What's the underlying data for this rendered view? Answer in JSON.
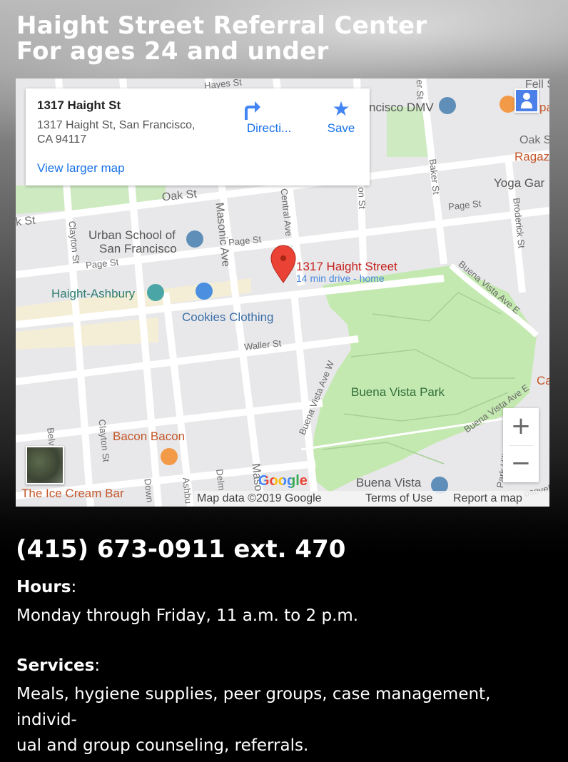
{
  "header": {
    "title_line1": "Haight Street Referral Center",
    "title_line2": "For ages 24 and under"
  },
  "map": {
    "info": {
      "place_name": "1317 Haight St",
      "address_line1": "1317 Haight St, San Francisco,",
      "address_line2": "CA 94117",
      "directions_label": "Directi...",
      "save_label": "Save",
      "view_larger_label": "View larger map"
    },
    "marker": {
      "label": "1317 Haight Street",
      "sublabel": "14 min drive - home"
    },
    "pois": {
      "urban_school_1": "Urban School of",
      "urban_school_2": "San Francisco",
      "haight_ashbury": "Haight-Ashbury",
      "cookies_clothing": "Cookies Clothing",
      "bacon_bacon": "Bacon Bacon",
      "ice_cream_bar": "The Ice Cream Bar",
      "buena_vista_park": "Buena Vista Park",
      "buena_vista": "Buena Vista",
      "dmv": "ncisco DMV",
      "yoga": "Yoga Gar",
      "ragaz": "Ragaz",
      "oak_right": "Oak S",
      "fell": "Fell S",
      "pa": "pa",
      "ca": "Ca"
    },
    "streets": {
      "hayes": "Hayes St",
      "oak": "Oak St",
      "k_st": "k St",
      "page1": "Page St",
      "page2": "Page St",
      "page3": "Page St",
      "waller": "Waller St",
      "clayton1": "Clayton St",
      "clayton2": "Clayton St",
      "masonic": "Masonic Ave",
      "central": "Central Ave",
      "baker": "Baker St",
      "broderick": "Broderick St",
      "lyon": "on St",
      "er_st": "er St",
      "buena_vista_ave_e1": "Buena Vista Ave E",
      "buena_vista_ave_e2": "Buena Vista Ave E",
      "buena_vista_ave_w": "Buena Vista Ave W",
      "park_hill": "Park Hill Ave",
      "belve": "Belve",
      "delm": "Delm",
      "ashbu": "Ashbu",
      "down": "Down",
      "maso": "Maso",
      "roosevelt": "osevelt"
    },
    "google_logo": "Google",
    "attribution": {
      "map_data": "Map data ©2019 Google",
      "terms": "Terms of Use",
      "report": "Report a map error"
    },
    "zoom_in": "+",
    "zoom_out": "−"
  },
  "contact": {
    "phone": "(415) 673-0911 ext. 470",
    "hours_label": "Hours",
    "hours_text": "Monday through Friday, 11 a.m. to 2 p.m.",
    "services_label": "Services",
    "services_line1": "Meals, hygiene supplies, peer groups, case management, individ-",
    "services_line2": "ual and group counseling, referrals."
  },
  "colors": {
    "link_blue": "#1a73e8",
    "park_green": "#c4e9b0",
    "marker_red": "#ea4335"
  }
}
